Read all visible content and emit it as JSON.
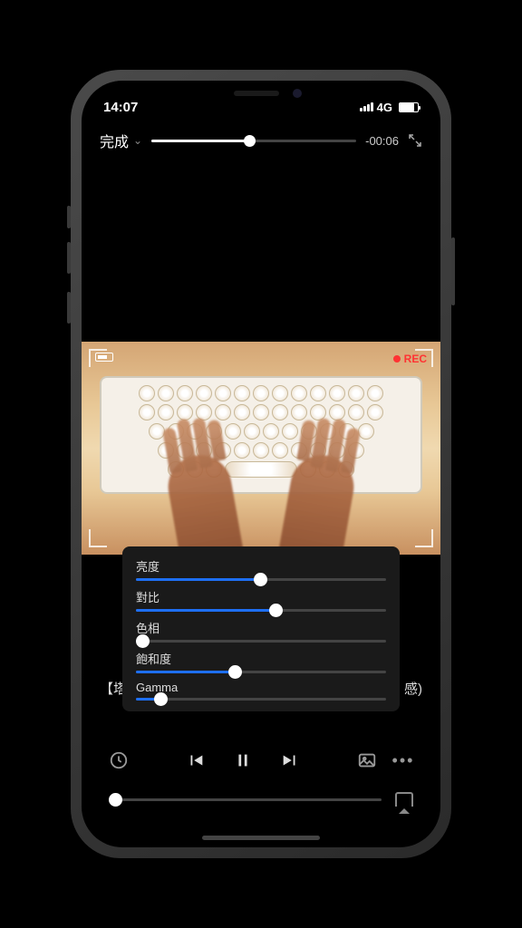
{
  "status": {
    "time": "14:07",
    "network": "4G"
  },
  "top": {
    "done_label": "完成",
    "time_remaining": "-00:06"
  },
  "video_overlay": {
    "rec_label": "REC"
  },
  "adjust": {
    "brightness": {
      "label": "亮度",
      "value_pct": 50
    },
    "contrast": {
      "label": "對比",
      "value_pct": 56
    },
    "hue": {
      "label": "色相",
      "value_pct": 3
    },
    "saturation": {
      "label": "飽和度",
      "value_pct": 40
    },
    "gamma": {
      "label": "Gamma",
      "value_pct": 10
    }
  },
  "title": {
    "prefix": "【塔",
    "suffix": "感)"
  }
}
